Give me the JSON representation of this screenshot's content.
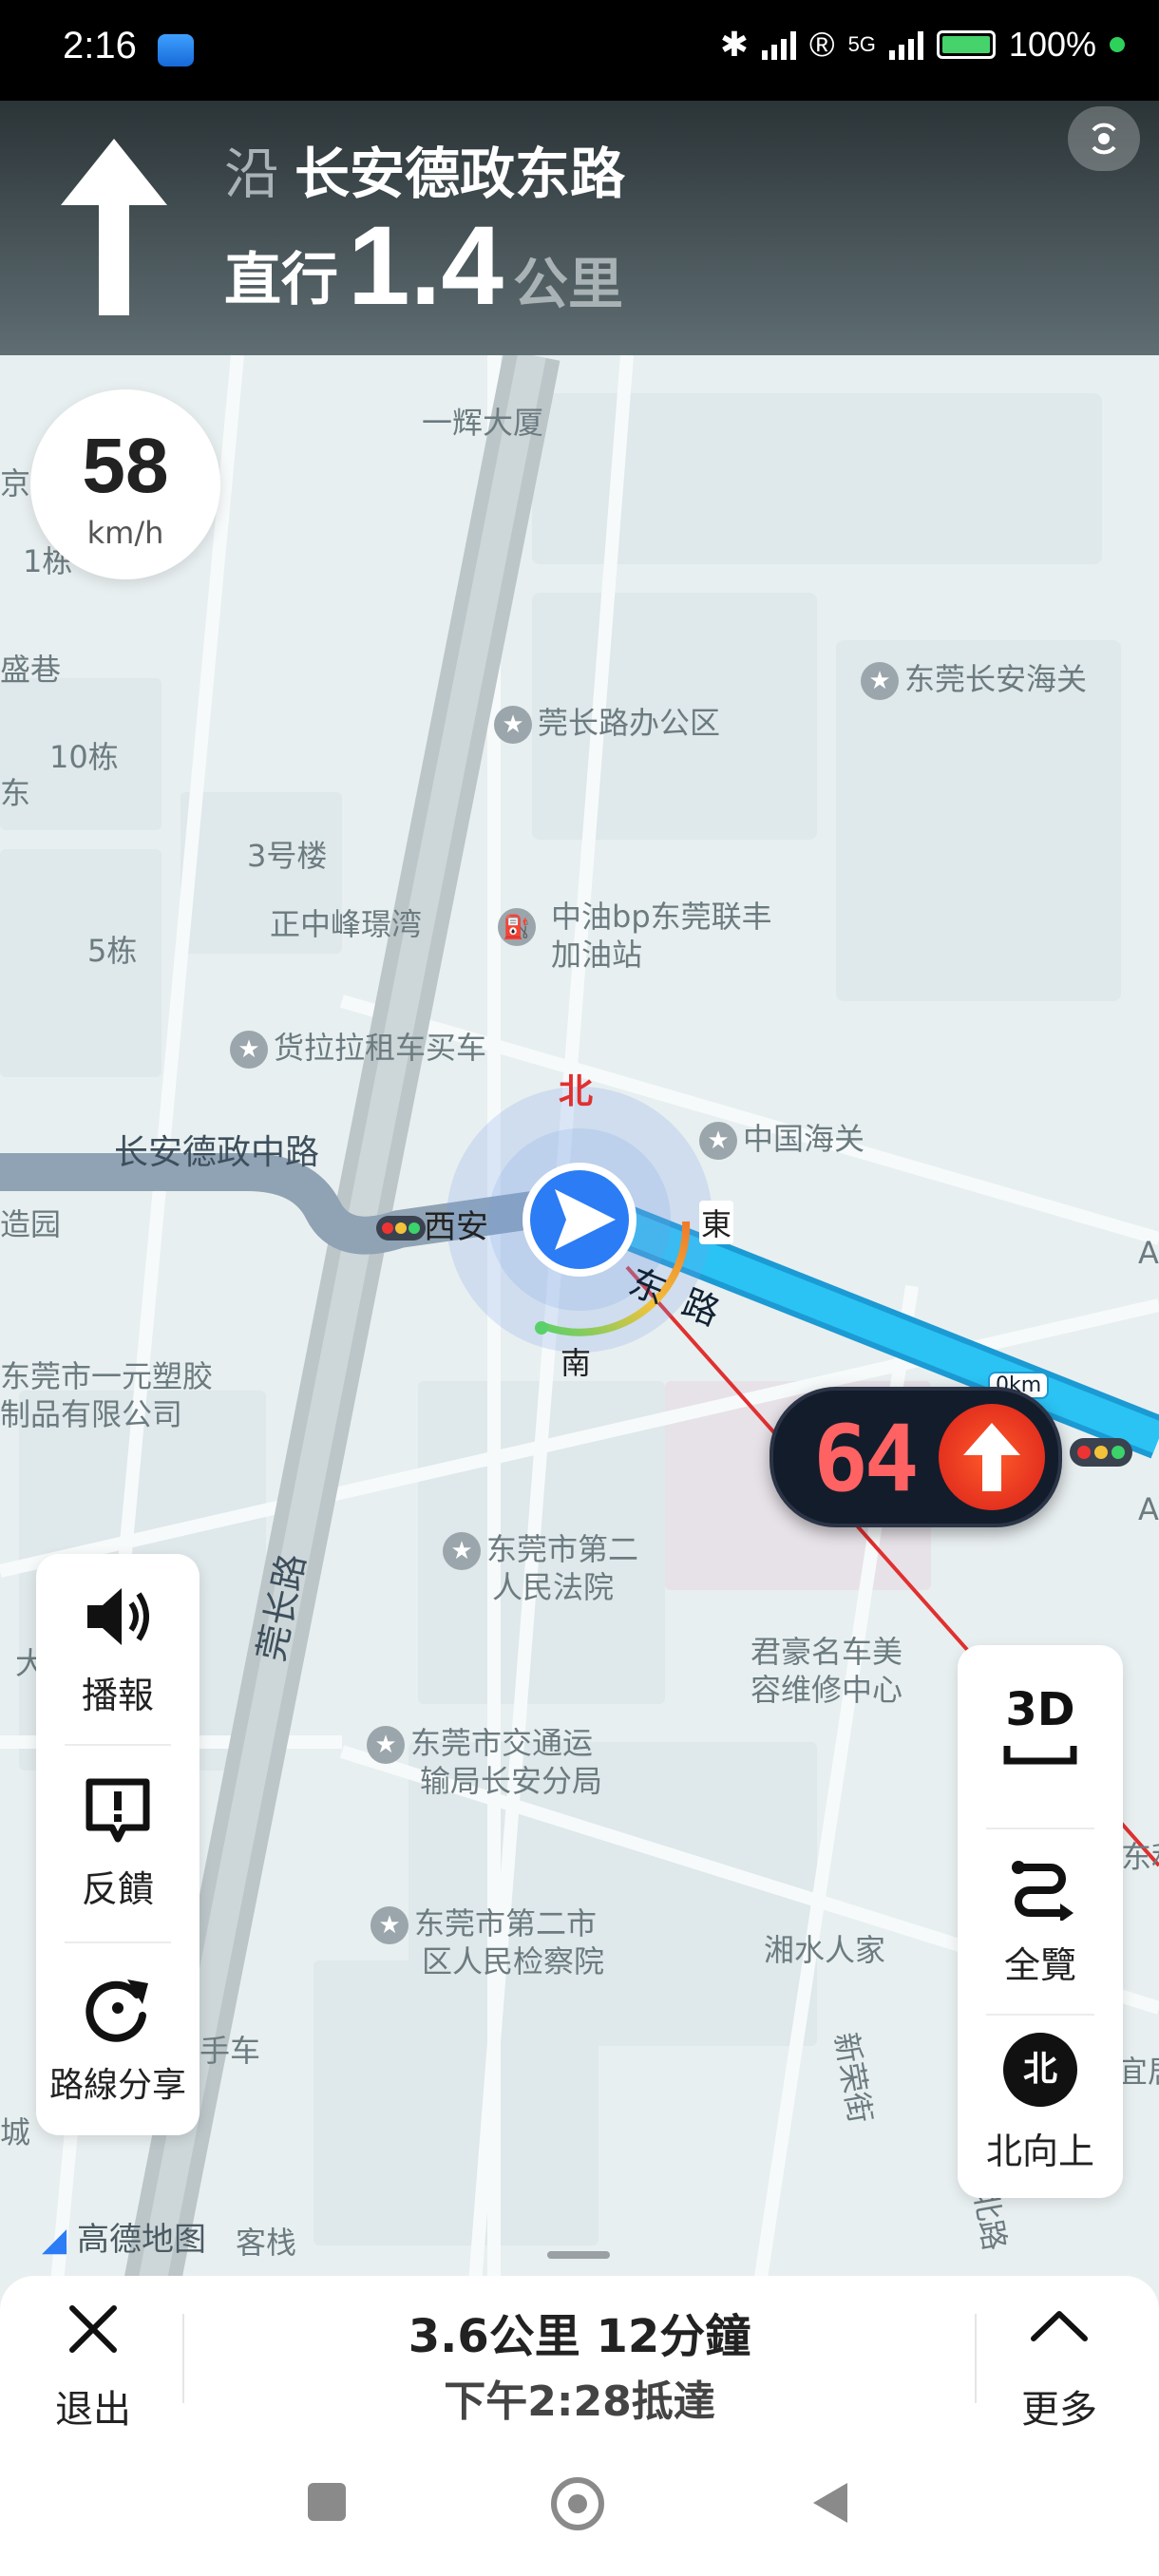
{
  "status_bar": {
    "time": "2:16",
    "battery": "100%",
    "network": "5G"
  },
  "nav_header": {
    "along_prefix": "沿",
    "road_name": "长安德政东路",
    "action": "直行",
    "distance": "1.4",
    "distance_unit": "公里"
  },
  "speed": {
    "value": "58",
    "unit": "km/h"
  },
  "map": {
    "labels": {
      "yihui": "一辉大厦",
      "customs_house": "东莞长安海关",
      "guancheng_office": "莞长路办公区",
      "bldg3": "3号楼",
      "b10": "10栋",
      "b5": "5栋",
      "zhengzhong": "正中峰璟湾",
      "bp_line1": "中油bp东莞联丰",
      "bp_line2": "加油站",
      "huolala": "货拉拉租车买车",
      "road_zhong": "长安德政中路",
      "customs": "中国海关",
      "road_east_1": "东",
      "road_east_2": "路",
      "plastic_line1": "东莞市一元塑胶",
      "plastic_line2": "制品有限公司",
      "court_line1": "东莞市第二",
      "court_line2": "人民法院",
      "car_line1": "君豪名车美",
      "car_line2": "容维修中心",
      "guancheng_road": "莞长路",
      "transport_line1": "东莞市交通运",
      "transport_line2": "输局长安分局",
      "procuratorate_line1": "东莞市第二市",
      "procuratorate_line2": "区人民检察院",
      "xiangshui": "湘水人家",
      "xinrong": "新荣街",
      "secondhand": "手车",
      "kezhan": "客栈",
      "lane": "盛巷",
      "north_road": "北路",
      "partial_jing": "京",
      "partial_dong": "东",
      "partial_cheng": "城",
      "partial_yuan": "造园",
      "partial_1": "1栋",
      "partial_da": "大",
      "partial_a1": "A",
      "partial_a2": "A",
      "partial_li": "东利",
      "partial_yi": "宜居",
      "west_an": "西安",
      "distance_badge": "0km"
    },
    "compass": {
      "north": "北",
      "east": "東",
      "south": "南"
    },
    "brand": "高德地图"
  },
  "traffic_light": {
    "speed": "64"
  },
  "left_panel": {
    "broadcast": "播報",
    "feedback": "反饋",
    "share": "路線分享"
  },
  "right_panel": {
    "mode_3d": "3D",
    "overview": "全覽",
    "north_up_icon_text": "北",
    "north_up": "北向上"
  },
  "bottom_bar": {
    "exit": "退出",
    "summary": "3.6公里  12分鐘",
    "eta": "下午2:28抵達",
    "more": "更多"
  },
  "colors": {
    "route": "#21b6ef",
    "header_top": "#2b3437",
    "traffic_red": "#ff6262",
    "accent_blue": "#2b7cf5"
  }
}
